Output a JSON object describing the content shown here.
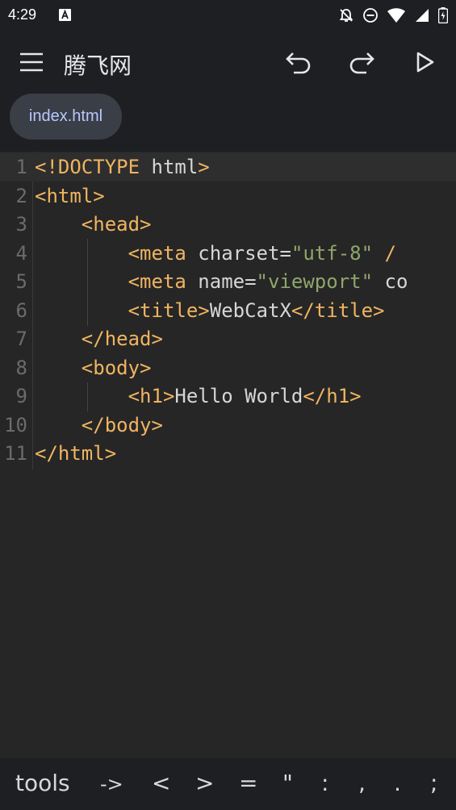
{
  "status": {
    "time": "4:29"
  },
  "appbar": {
    "title": "腾飞网"
  },
  "tabs": [
    {
      "label": "index.html"
    }
  ],
  "editor": {
    "lines": [
      {
        "num": "1",
        "tokens": [
          {
            "t": "<!DOCTYPE ",
            "c": "tag"
          },
          {
            "t": "html",
            "c": "txt"
          },
          {
            "t": ">",
            "c": "tag"
          }
        ]
      },
      {
        "num": "2",
        "tokens": [
          {
            "t": "<html>",
            "c": "tag"
          }
        ]
      },
      {
        "num": "3",
        "tokens": [
          {
            "t": "    ",
            "c": "txt"
          },
          {
            "t": "<head>",
            "c": "tag"
          }
        ]
      },
      {
        "num": "4",
        "tokens": [
          {
            "t": "        ",
            "c": "txt"
          },
          {
            "t": "<meta ",
            "c": "tag"
          },
          {
            "t": "charset=",
            "c": "attr"
          },
          {
            "t": "\"utf-8\"",
            "c": "str"
          },
          {
            "t": " /",
            "c": "tag"
          }
        ]
      },
      {
        "num": "5",
        "tokens": [
          {
            "t": "        ",
            "c": "txt"
          },
          {
            "t": "<meta ",
            "c": "tag"
          },
          {
            "t": "name=",
            "c": "attr"
          },
          {
            "t": "\"viewport\"",
            "c": "str"
          },
          {
            "t": " co",
            "c": "attr"
          }
        ]
      },
      {
        "num": "6",
        "tokens": [
          {
            "t": "        ",
            "c": "txt"
          },
          {
            "t": "<title>",
            "c": "tag"
          },
          {
            "t": "WebCatX",
            "c": "txt"
          },
          {
            "t": "</title>",
            "c": "tag"
          }
        ]
      },
      {
        "num": "7",
        "tokens": [
          {
            "t": "    ",
            "c": "txt"
          },
          {
            "t": "</head>",
            "c": "tag"
          }
        ]
      },
      {
        "num": "8",
        "tokens": [
          {
            "t": "    ",
            "c": "txt"
          },
          {
            "t": "<body>",
            "c": "tag"
          }
        ]
      },
      {
        "num": "9",
        "tokens": [
          {
            "t": "        ",
            "c": "txt"
          },
          {
            "t": "<h1>",
            "c": "tag"
          },
          {
            "t": "Hello World",
            "c": "txt"
          },
          {
            "t": "</h1>",
            "c": "tag"
          }
        ]
      },
      {
        "num": "10",
        "tokens": [
          {
            "t": "    ",
            "c": "txt"
          },
          {
            "t": "</body>",
            "c": "tag"
          }
        ]
      },
      {
        "num": "11",
        "tokens": [
          {
            "t": "</html>",
            "c": "tag"
          }
        ]
      }
    ]
  },
  "symbols": [
    "tools",
    "->",
    "<",
    ">",
    "=",
    "\"",
    ":",
    ",",
    ".",
    ";"
  ]
}
